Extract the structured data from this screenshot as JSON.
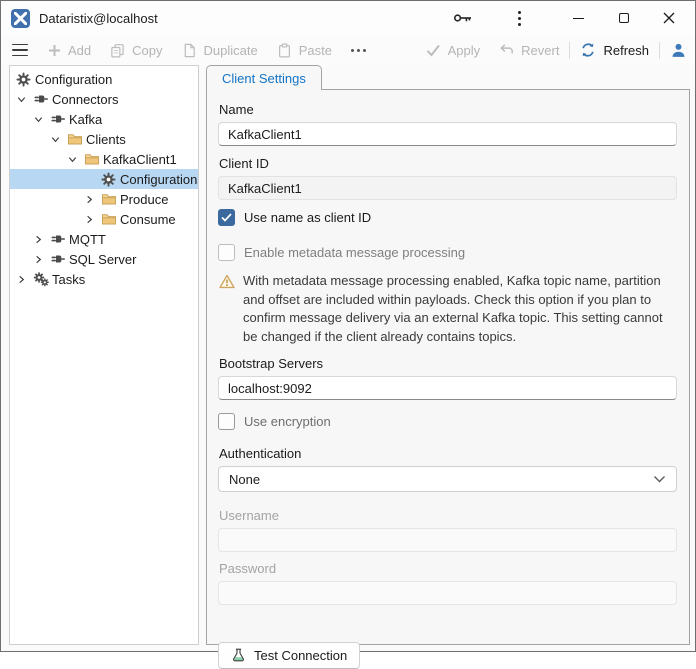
{
  "titlebar": {
    "title": "Dataristix@localhost"
  },
  "toolbar": {
    "add_label": "Add",
    "copy_label": "Copy",
    "duplicate_label": "Duplicate",
    "paste_label": "Paste",
    "apply_label": "Apply",
    "revert_label": "Revert",
    "refresh_label": "Refresh"
  },
  "tree": {
    "items": [
      {
        "label": "Configuration",
        "icon": "gear-icon",
        "level": 0,
        "selected": false
      },
      {
        "label": "Connectors",
        "icon": "plug-icon",
        "level": 0,
        "expanded": true
      },
      {
        "label": "Kafka",
        "icon": "plug-icon",
        "level": 1,
        "expanded": true
      },
      {
        "label": "Clients",
        "icon": "folder-icon",
        "level": 2,
        "expanded": true
      },
      {
        "label": "KafkaClient1",
        "icon": "folder-icon",
        "level": 3,
        "expanded": true
      },
      {
        "label": "Configuration",
        "icon": "gear-icon",
        "level": 5,
        "selected": true
      },
      {
        "label": "Produce",
        "icon": "folder-icon",
        "level": 4,
        "expanded": false
      },
      {
        "label": "Consume",
        "icon": "folder-icon",
        "level": 4,
        "expanded": false
      },
      {
        "label": "MQTT",
        "icon": "plug-icon",
        "level": 1,
        "expanded": false
      },
      {
        "label": "SQL Server",
        "icon": "plug-icon",
        "level": 1,
        "expanded": false
      },
      {
        "label": "Tasks",
        "icon": "gears-icon",
        "level": 0,
        "expanded": false
      }
    ]
  },
  "tab": {
    "label": "Client Settings"
  },
  "form": {
    "name_label": "Name",
    "name_value": "KafkaClient1",
    "client_id_label": "Client ID",
    "client_id_value": "KafkaClient1",
    "use_name_label": "Use name as client ID",
    "metadata_label": "Enable metadata message processing",
    "warning_text": "With metadata message processing enabled, Kafka topic name, partition and offset are included within payloads. Check this option if you plan to confirm message delivery via an external Kafka topic. This setting cannot be changed if the client already contains topics.",
    "bootstrap_label": "Bootstrap Servers",
    "bootstrap_value": "localhost:9092",
    "encryption_label": "Use encryption",
    "auth_label": "Authentication",
    "auth_value": "None",
    "username_label": "Username",
    "username_value": "",
    "password_label": "Password",
    "password_value": "",
    "test_button_label": "Test Connection"
  },
  "icons": {
    "app-icon": "blue rounded square with white x",
    "hamburger-icon": "≡",
    "plus-icon": "+",
    "copy-icon": "⧉",
    "duplicate-icon": "⎘",
    "paste-icon": "📋",
    "ellipsis-icon": "⋯",
    "check-icon": "✓",
    "undo-icon": "↶",
    "refresh-icon": "⟳",
    "user-icon": "👤",
    "key-icon": "🔑",
    "kebab-icon": "⋮",
    "minimize-icon": "–",
    "maximize-icon": "□",
    "close-icon": "✕",
    "gear-icon": "⚙",
    "gears-icon": "⚙⚙",
    "plug-icon": "🔌",
    "folder-icon": "📁",
    "chevron-down-icon": "⌄",
    "chevron-right-icon": "›",
    "warning-icon": "⚠",
    "flask-icon": "⚗"
  },
  "colors": {
    "app_icon_blue": "#4170ae",
    "tab_text_blue": "#1374c5",
    "checkbox_blue": "#3a6a9e",
    "selection_blue": "#b7d7f2",
    "refresh_blue": "#3a74ad",
    "user_blue": "#3d7ab7",
    "warning_amber": "#cda45e",
    "folder_tan": "#efc57a",
    "flask_green": "#8fd0ac"
  }
}
